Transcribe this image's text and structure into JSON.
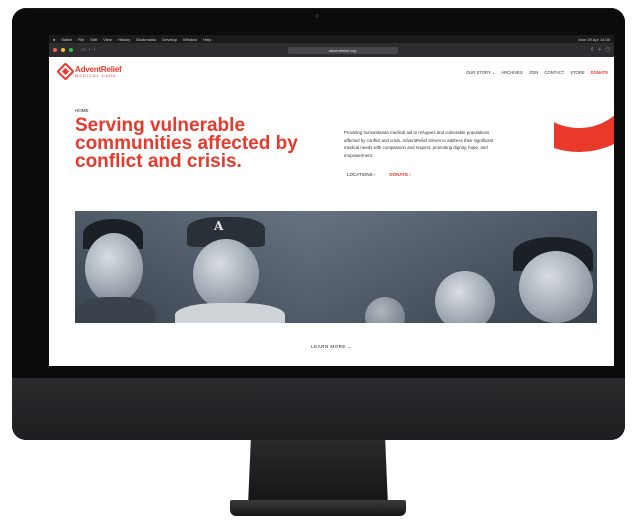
{
  "menubar": {
    "app": "Safari",
    "items": [
      "File",
      "Edit",
      "View",
      "History",
      "Bookmarks",
      "Develop",
      "Window",
      "Help"
    ],
    "clock": "Mon 29 Apr 14:30"
  },
  "browser": {
    "url": "adventrelief.org"
  },
  "site": {
    "logo_name": "AdventRelief",
    "logo_sub": "MEDICAL CARE",
    "nav": [
      "OUR STORY ⌄",
      "ARCHIVES",
      "JOIN",
      "CONTACT",
      "STORE",
      "DONATE"
    ],
    "breadcrumb": "HOME",
    "headline": "Serving vulnerable communities affected by conflict and crisis.",
    "description": "Providing humanitarian medical aid to refugees and vulnerable populations affected by conflict and crisis. AdventRelief strives to address their significant medical needs with compassion and respect, promoting dignity, hope, and empowerment.",
    "cta_locations": "LOCATIONS  ›",
    "cta_donate": "DONATE ›",
    "learn_more": "LEARN MORE  ⌄"
  },
  "colors": {
    "brand": "#e8392b",
    "bezel": "#0b0b0c"
  },
  "icons": {
    "device_logo": "apple-logo"
  }
}
